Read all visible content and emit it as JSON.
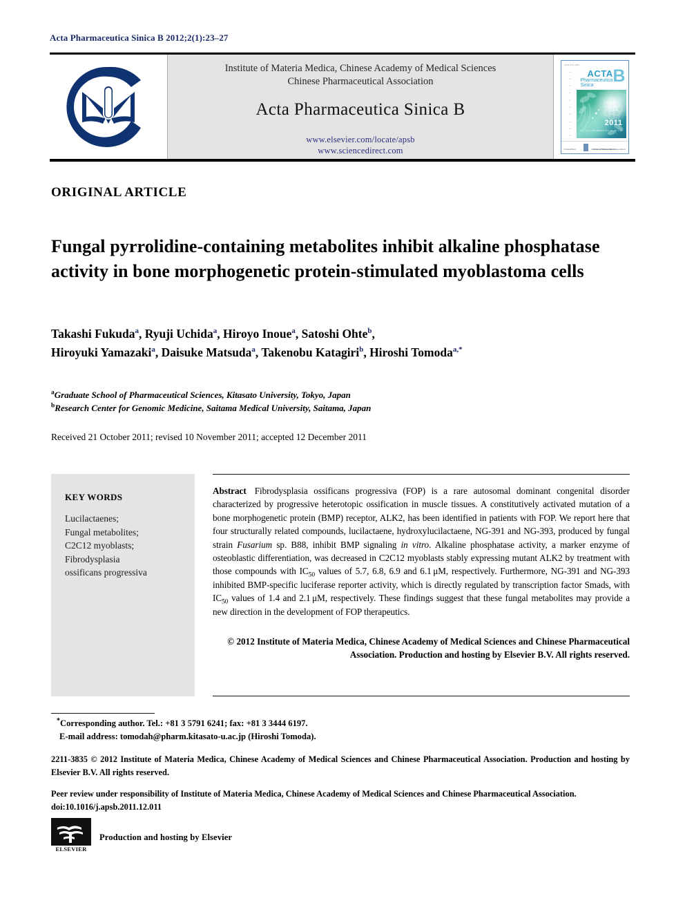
{
  "running_head": "Acta Pharmaceutica Sinica B 2012;2(1):23–27",
  "masthead": {
    "logo_name": "institute-of-materia-medica-logo",
    "org_line1": "Institute of Materia Medica, Chinese Academy of Medical Sciences",
    "org_line2": "Chinese Pharmaceutical Association",
    "journal_title": "Acta Pharmaceutica Sinica B",
    "url_elsevier": "www.elsevier.com/locate/apsb",
    "url_sciencedirect": "www.sciencedirect.com",
    "cover": {
      "top_note": "ISSN 2211-3835",
      "acta": "ACTA",
      "sub_line1": "Pharmaceutica",
      "sub_line2": "Sinica",
      "big_letter": "B",
      "year": "2011",
      "volume_info": "Vol. 1   No. 1\nDECEMBER 2011\nPAGES 1–80",
      "bottom_left": "ScienceDirect",
      "bottom_mid": "Institute of Materia Medica",
      "bottom_right": "Chinese Pharmaceutical Association"
    }
  },
  "article_type": "ORIGINAL ARTICLE",
  "title": "Fungal pyrrolidine-containing metabolites inhibit alkaline phosphatase activity in bone morphogenetic protein-stimulated myoblastoma cells",
  "authors": [
    {
      "name": "Takashi Fukuda",
      "sup": "a",
      "sep": ", "
    },
    {
      "name": "Ryuji Uchida",
      "sup": "a",
      "sep": ", "
    },
    {
      "name": "Hiroyo Inoue",
      "sup": "a",
      "sep": ", "
    },
    {
      "name": "Satoshi Ohte",
      "sup": "b",
      "sep": ", "
    },
    {
      "name": "Hiroyuki Yamazaki",
      "sup": "a",
      "sep": ", "
    },
    {
      "name": "Daisuke Matsuda",
      "sup": "a",
      "sep": ", "
    },
    {
      "name": "Takenobu Katagiri",
      "sup": "b",
      "sep": ", "
    },
    {
      "name": "Hiroshi Tomoda",
      "sup": "a,*",
      "sep": ""
    }
  ],
  "affiliations": [
    {
      "marker": "a",
      "text": "Graduate School of Pharmaceutical Sciences, Kitasato University, Tokyo, Japan"
    },
    {
      "marker": "b",
      "text": "Research Center for Genomic Medicine, Saitama Medical University, Saitama, Japan"
    }
  ],
  "history": "Received 21 October 2011; revised 10 November 2011; accepted 12 December 2011",
  "keywords": {
    "heading": "KEY WORDS",
    "items": [
      "Lucilactaenes;",
      "Fungal metabolites;",
      "C2C12 myoblasts;",
      "Fibrodysplasia",
      "ossificans progressiva"
    ]
  },
  "abstract": {
    "label": "Abstract",
    "part1": "Fibrodysplasia ossificans progressiva (FOP) is a rare autosomal dominant congenital disorder characterized by progressive heterotopic ossification in muscle tissues. A constitutively activated mutation of a bone morphogenetic protein (BMP) receptor, ALK2, has been identified in patients with FOP. We report here that four structurally related compounds, lucilactaene, hydroxylucilactaene, NG-391 and NG-393, produced by fungal strain ",
    "italic1": "Fusarium",
    "part2": " sp. B88, inhibit BMP signaling ",
    "italic2": "in vitro",
    "part3": ". Alkaline phosphatase activity, a marker enzyme of osteoblastic differentiation, was decreased in C2C12 myoblasts stably expressing mutant ALK2 by treatment with those compounds with IC",
    "sub1": "50",
    "part4": " values of 5.7, 6.8, 6.9 and 6.1 μM, respectively. Furthermore, NG-391 and NG-393 inhibited BMP-specific luciferase reporter activity, which is directly regulated by transcription factor Smads, with IC",
    "sub2": "50",
    "part5": " values of 1.4 and 2.1 μM, respectively. These findings suggest that these fungal metabolites may provide a new direction in the development of FOP therapeutics.",
    "copyright": "© 2012 Institute of Materia Medica, Chinese Academy of Medical Sciences and Chinese Pharmaceutical Association. Production and hosting by Elsevier B.V. All rights reserved."
  },
  "footnotes": {
    "corresponding_line1": "Corresponding author. Tel.: +81 3 5791 6241; fax: +81 3 3444 6197.",
    "corresponding_line2": "E-mail address: tomodah@pharm.kitasato-u.ac.jp (Hiroshi Tomoda).",
    "issn_copyright": "2211-3835 © 2012 Institute of Materia Medica, Chinese Academy of Medical Sciences and Chinese Pharmaceutical Association. Production and hosting by Elsevier B.V. All rights reserved.",
    "peer_review": "Peer review under responsibility of Institute of Materia Medica, Chinese Academy of Medical Sciences and Chinese Pharmaceutical Association.",
    "doi": "doi:10.1016/j.apsb.2011.12.011"
  },
  "elsevier_footer": {
    "logo_name": "elsevier-tree-logo",
    "wordmark": "ELSEVIER",
    "caption": "Production and hosting by Elsevier"
  },
  "colors": {
    "accent_navy": "#1b2a66",
    "url_blue": "#2b2f80",
    "masthead_gray": "#e3e3e3",
    "keywords_gray": "#e4e4e4",
    "cover_teal": "#2e9ec9"
  }
}
